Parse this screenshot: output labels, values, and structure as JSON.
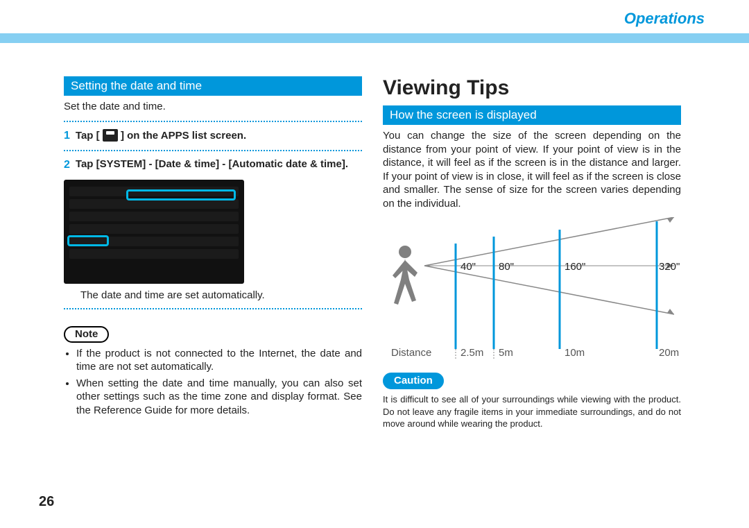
{
  "header": {
    "section": "Operations"
  },
  "left": {
    "bar1": "Setting the date and time",
    "intro": "Set the date and time.",
    "step1_pre": "Tap [",
    "step1_post": "] on the APPS list screen.",
    "step2": "Tap [SYSTEM] - [Date & time] - [Automatic date & time].",
    "after_screenshot": "The date and time are set automatically.",
    "note_label": "Note",
    "note1": "If the product is not connected to the Internet, the date and time are not set automatically.",
    "note2": "When setting the date and time manually, you can also set other settings such as the time zone and display format. See the Reference Guide for more details."
  },
  "right": {
    "title": "Viewing Tips",
    "bar": "How the screen is displayed",
    "para": "You can change the size of the screen depending on the distance from your point of view. If your point of view is in the distance, it will feel as if the screen is in the distance and larger. If your point of view is in close, it will feel as if the screen is close and smaller. The sense of size for the screen varies depending on the individual.",
    "sizes": {
      "a": "40\"",
      "b": "80\"",
      "c": "160\"",
      "d": "320\""
    },
    "distance_label": "Distance",
    "dist": {
      "a": "2.5m",
      "b": "5m",
      "c": "10m",
      "d": "20m"
    },
    "caution_label": "Caution",
    "caution_text": "It is difficult to see all of your surroundings while viewing with the product. Do not leave any fragile items in your immediate surroundings, and do not move around while wearing the product."
  },
  "page_number": "26"
}
